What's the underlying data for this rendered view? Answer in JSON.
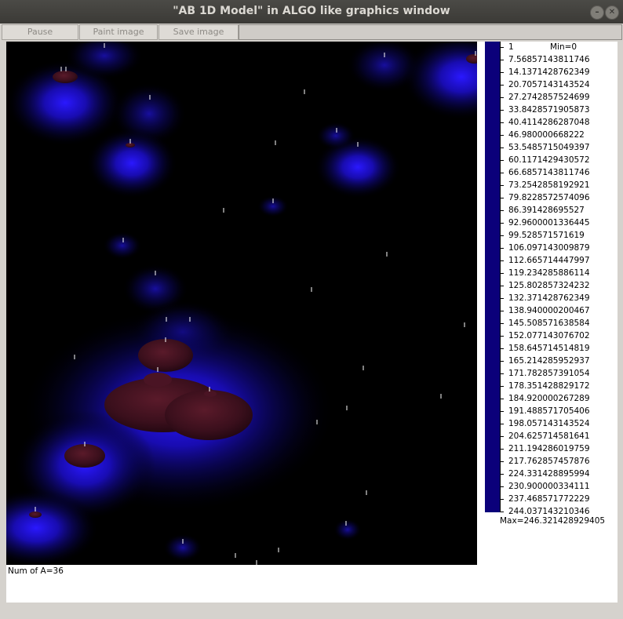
{
  "window": {
    "title": "\"AB 1D Model\" in ALGO like graphics window"
  },
  "toolbar": {
    "pause_label": "Pause",
    "paint_label": "Paint image",
    "save_label": "Save image"
  },
  "legend": {
    "min_label": "Min=0",
    "max_label": "Max=246.321428929405",
    "ticks": [
      "1",
      "7.56857143811746",
      "14.1371428762349",
      "20.7057143143524",
      "27.2742857524699",
      "33.8428571905873",
      "40.4114286287048",
      "46.980000668222",
      "53.5485715049397",
      "60.1171429430572",
      "66.6857143811746",
      "73.2542858192921",
      "79.8228572574096",
      "86.391428695527",
      "92.9600001336445",
      "99.528571571619",
      "106.097143009879",
      "112.665714447997",
      "119.234285886114",
      "125.802857324232",
      "132.371428762349",
      "138.940000200467",
      "145.508571638584",
      "152.077143076702",
      "158.645714514819",
      "165.214285952937",
      "171.782857391054",
      "178.351428829172",
      "184.920000267289",
      "191.488571705406",
      "198.057143143524",
      "204.625714581641",
      "211.194286019759",
      "217.762857457876",
      "224.331428895994",
      "230.900000334111",
      "237.468571772229",
      "244.037143210346"
    ],
    "bar_color": "#0b007a"
  },
  "status": {
    "num_text": "Num of A=36"
  }
}
